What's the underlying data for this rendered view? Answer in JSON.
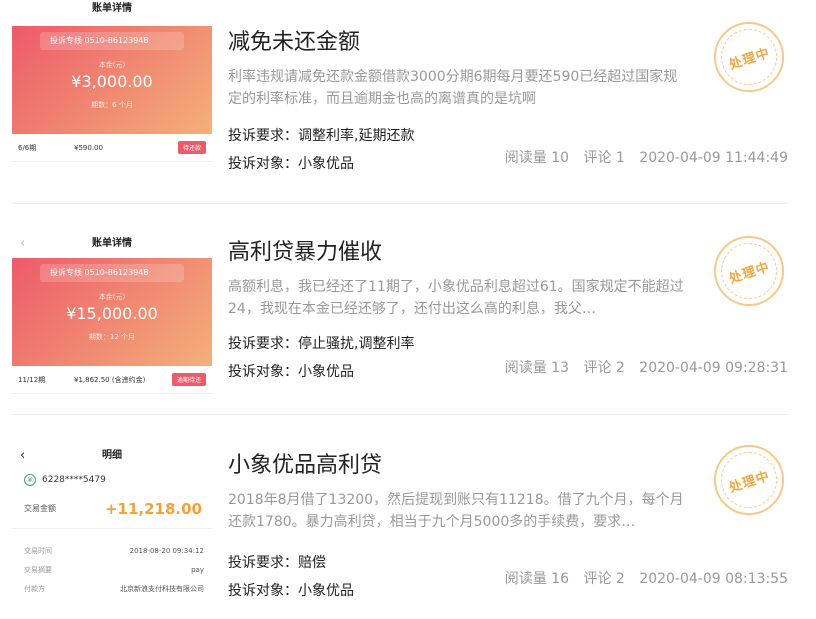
{
  "items": [
    {
      "title": "减免未还金额",
      "desc": "利率违规请减免还款金额借款3000分期6期每月要还590已经超过国家规定的利率标准，而且逾期金也高的离谱真的是坑啊",
      "requirement": "投诉要求：调整利率,延期还款",
      "target": "投诉对象：小象优品",
      "reads": "阅读量 10",
      "comments": "评论 1",
      "time": "2020-04-09 11:44:49",
      "status": "处理中",
      "thumb": {
        "header": "账单详情",
        "hotline": "投诉专线  0510-86123948",
        "sub_label": "本金(元)",
        "amount": "¥3,000.00",
        "period": "期数：6 个月",
        "row_term": "6/6期",
        "row_amount": "¥590.00",
        "row_button": "待还款"
      }
    },
    {
      "title": "高利贷暴力催收",
      "desc": "高额利息，我已经还了11期了，小象优品利息超过61。国家规定不能超过24，我现在本金已经还够了，还付出这么高的利息，我父…",
      "requirement": "投诉要求：停止骚扰,调整利率",
      "target": "投诉对象：小象优品",
      "reads": "阅读量 13",
      "comments": "评论 2",
      "time": "2020-04-09 09:28:31",
      "status": "处理中",
      "thumb": {
        "header": "账单详情",
        "hotline": "投诉专线  0510-86123948",
        "sub_label": "本金(元)",
        "amount": "¥15,000.00",
        "period": "期数：12 个月",
        "row_term": "11/12期",
        "row_amount": "¥1,862.50 (含违约金)",
        "row_button": "逾期待还"
      }
    },
    {
      "title": "小象优品高利贷",
      "desc": "2018年8月借了13200，然后提现到账只有11218。借了九个月，每个月还款1780。暴力高利贷，相当于九个月5000多的手续费，要求…",
      "requirement": "投诉要求：赔偿",
      "target": "投诉对象：小象优品",
      "reads": "阅读量 16",
      "comments": "评论 2",
      "time": "2020-04-09 08:13:55",
      "status": "处理中",
      "thumb": {
        "header": "明细",
        "card_no": "6228****5479",
        "amount_label": "交易金额",
        "amount": "+11,218.00",
        "lines": [
          {
            "k": "交易时间",
            "v": "2018-08-20 09:34:12"
          },
          {
            "k": "交易摘要",
            "v": "pay"
          },
          {
            "k": "付款方",
            "v": "北京新浪支付科技有限公司"
          }
        ]
      }
    }
  ],
  "colors": {
    "stamp": "#f0a94a",
    "bill_gradient_start": "#ee5a6a",
    "amount_orange": "#f4a23b"
  },
  "icons": {
    "back": "chevron-left-icon",
    "bank": "bank-card-icon"
  }
}
